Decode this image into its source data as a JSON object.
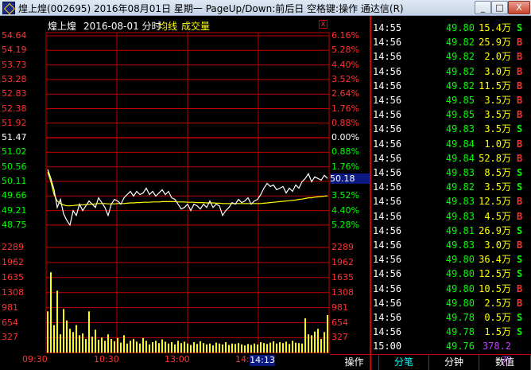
{
  "window": {
    "title": "煌上煌(002695) 2016年08月01日 星期一 PageUp/Down:前后日 空格键:操作 通达信(R)",
    "minimize": "_",
    "maximize": "□",
    "close": "X"
  },
  "header": {
    "stock": "煌上煌",
    "date_info": "2016-08-01 分时",
    "avg_label": "均线",
    "vol_label": "成交量",
    "close_icon": "X"
  },
  "colors": {
    "up": "#ff3232",
    "down": "#00ff00",
    "flat": "#ffffff",
    "avg": "#ffff00",
    "grid": "#c00000",
    "vol_up": "#ffff00"
  },
  "price_axis": {
    "left": [
      "54.64",
      "54.19",
      "53.73",
      "53.28",
      "52.83",
      "52.38",
      "51.92",
      "51.47",
      "51.02",
      "50.56",
      "50.11",
      "49.66",
      "49.21",
      "48.75"
    ],
    "right": [
      "6.16%",
      "5.28%",
      "4.40%",
      "3.52%",
      "2.64%",
      "1.76%",
      "0.88%",
      "0.00%",
      "0.88%",
      "1.76%",
      "2.64%",
      "3.52%",
      "4.40%",
      "5.28%"
    ]
  },
  "volume_axis": {
    "left": [
      "2289",
      "1962",
      "1635",
      "1308",
      "981",
      "654",
      "327"
    ],
    "right": [
      "2289",
      "1962",
      "1635",
      "1308",
      "981",
      "654",
      "327"
    ]
  },
  "time_axis": [
    "09:30",
    "10:30",
    "13:00",
    "14:"
  ],
  "cursor": {
    "price": "50.18",
    "time": "14:13"
  },
  "chart_data": {
    "type": "line",
    "x_range": [
      "09:30",
      "15:00"
    ],
    "ylim": [
      48.75,
      54.64
    ],
    "prev_close": 51.47,
    "series": [
      {
        "name": "分时",
        "values": [
          50.48,
          50.2,
          49.85,
          49.3,
          49.55,
          49.1,
          48.9,
          48.75,
          49.2,
          49.05,
          49.4,
          49.2,
          49.35,
          49.5,
          49.4,
          49.3,
          49.6,
          49.45,
          49.3,
          49.05,
          49.4,
          49.55,
          49.5,
          49.4,
          49.6,
          49.7,
          49.8,
          49.65,
          49.8,
          49.7,
          49.75,
          49.9,
          49.7,
          49.8,
          49.65,
          49.75,
          49.85,
          49.7,
          49.8,
          49.6,
          49.55,
          49.4,
          49.25,
          49.3,
          49.4,
          49.2,
          49.4,
          49.35,
          49.25,
          49.4,
          49.3,
          49.5,
          49.3,
          49.4,
          49.35,
          49.05,
          49.2,
          49.3,
          49.45,
          49.4,
          49.55,
          49.45,
          49.5,
          49.6,
          49.4,
          49.5,
          49.55,
          49.7,
          49.9,
          50.05,
          49.95,
          50.0,
          49.85,
          49.9,
          49.95,
          49.75,
          49.9,
          49.8,
          50.0,
          49.9,
          50.1,
          50.2,
          50.35,
          50.1,
          50.25,
          50.2,
          50.15,
          50.3,
          50.2
        ]
      },
      {
        "name": "均线",
        "values": [
          50.4,
          50.1,
          49.7,
          49.5,
          49.42,
          49.38,
          49.35,
          49.35,
          49.36,
          49.37,
          49.38,
          49.38,
          49.39,
          49.4,
          49.4,
          49.41,
          49.42,
          49.42,
          49.42,
          49.41,
          49.41,
          49.41,
          49.42,
          49.42,
          49.42,
          49.43,
          49.44,
          49.44,
          49.45,
          49.45,
          49.46,
          49.46,
          49.46,
          49.47,
          49.47,
          49.47,
          49.48,
          49.48,
          49.48,
          49.48,
          49.48,
          49.47,
          49.47,
          49.47,
          49.46,
          49.46,
          49.46,
          49.45,
          49.45,
          49.45,
          49.44,
          49.44,
          49.44,
          49.43,
          49.43,
          49.42,
          49.42,
          49.42,
          49.42,
          49.42,
          49.42,
          49.42,
          49.42,
          49.42,
          49.42,
          49.42,
          49.42,
          49.42,
          49.43,
          49.44,
          49.45,
          49.46,
          49.47,
          49.48,
          49.49,
          49.5,
          49.51,
          49.52,
          49.53,
          49.55,
          49.56,
          49.58,
          49.6,
          49.6,
          49.62,
          49.63,
          49.64,
          49.65,
          49.66
        ]
      }
    ],
    "volume": {
      "ylim": [
        0,
        2289
      ],
      "values": [
        900,
        1750,
        600,
        1350,
        400,
        950,
        700,
        520,
        450,
        600,
        380,
        420,
        300,
        900,
        350,
        500,
        280,
        330,
        260,
        400,
        300,
        250,
        320,
        220,
        380,
        200,
        260,
        300,
        240,
        200,
        320,
        260,
        180,
        230,
        260,
        210,
        290,
        240,
        200,
        230,
        180,
        260,
        210,
        240,
        200,
        170,
        230,
        190,
        250,
        210,
        180,
        200,
        160,
        220,
        200,
        180,
        230,
        170,
        200,
        190,
        210,
        180,
        160,
        190,
        170,
        200,
        180,
        230,
        210,
        190,
        220,
        250,
        200,
        230,
        210,
        240,
        190,
        260,
        220,
        210,
        200,
        750,
        400,
        380,
        460,
        520,
        300,
        450,
        820
      ]
    }
  },
  "ticks": [
    {
      "time": "14:55",
      "price": "49.80",
      "vol": "15.4万",
      "side": "S"
    },
    {
      "time": "14:56",
      "price": "49.82",
      "vol": "25.9万",
      "side": "B"
    },
    {
      "time": "14:56",
      "price": "49.82",
      "vol": "2.0万",
      "side": "B"
    },
    {
      "time": "14:56",
      "price": "49.82",
      "vol": "3.0万",
      "side": "B"
    },
    {
      "time": "14:56",
      "price": "49.82",
      "vol": "11.5万",
      "side": "B"
    },
    {
      "time": "14:56",
      "price": "49.85",
      "vol": "3.5万",
      "side": "B"
    },
    {
      "time": "14:56",
      "price": "49.85",
      "vol": "3.5万",
      "side": "B"
    },
    {
      "time": "14:56",
      "price": "49.83",
      "vol": "3.5万",
      "side": "S"
    },
    {
      "time": "14:56",
      "price": "49.84",
      "vol": "1.0万",
      "side": "B"
    },
    {
      "time": "14:56",
      "price": "49.84",
      "vol": "52.8万",
      "side": "B"
    },
    {
      "time": "14:56",
      "price": "49.83",
      "vol": "8.5万",
      "side": "S"
    },
    {
      "time": "14:56",
      "price": "49.82",
      "vol": "3.5万",
      "side": "S"
    },
    {
      "time": "14:56",
      "price": "49.83",
      "vol": "12.5万",
      "side": "B"
    },
    {
      "time": "14:56",
      "price": "49.83",
      "vol": "4.5万",
      "side": "B"
    },
    {
      "time": "14:56",
      "price": "49.81",
      "vol": "26.9万",
      "side": "S"
    },
    {
      "time": "14:56",
      "price": "49.83",
      "vol": "3.0万",
      "side": "B"
    },
    {
      "time": "14:56",
      "price": "49.80",
      "vol": "36.4万",
      "side": "S"
    },
    {
      "time": "14:56",
      "price": "49.80",
      "vol": "12.5万",
      "side": "S"
    },
    {
      "time": "14:56",
      "price": "49.80",
      "vol": "10.5万",
      "side": "B"
    },
    {
      "time": "14:56",
      "price": "49.80",
      "vol": "2.5万",
      "side": "B"
    },
    {
      "time": "14:56",
      "price": "49.78",
      "vol": "0.5万",
      "side": "S"
    },
    {
      "time": "14:56",
      "price": "49.78",
      "vol": "1.5万",
      "side": "S"
    },
    {
      "time": "15:00",
      "price": "49.76",
      "vol": "378.2万",
      "side": ""
    }
  ],
  "tabs": [
    "操作",
    "分笔",
    "分钟",
    "数值"
  ],
  "active_tab": 1
}
